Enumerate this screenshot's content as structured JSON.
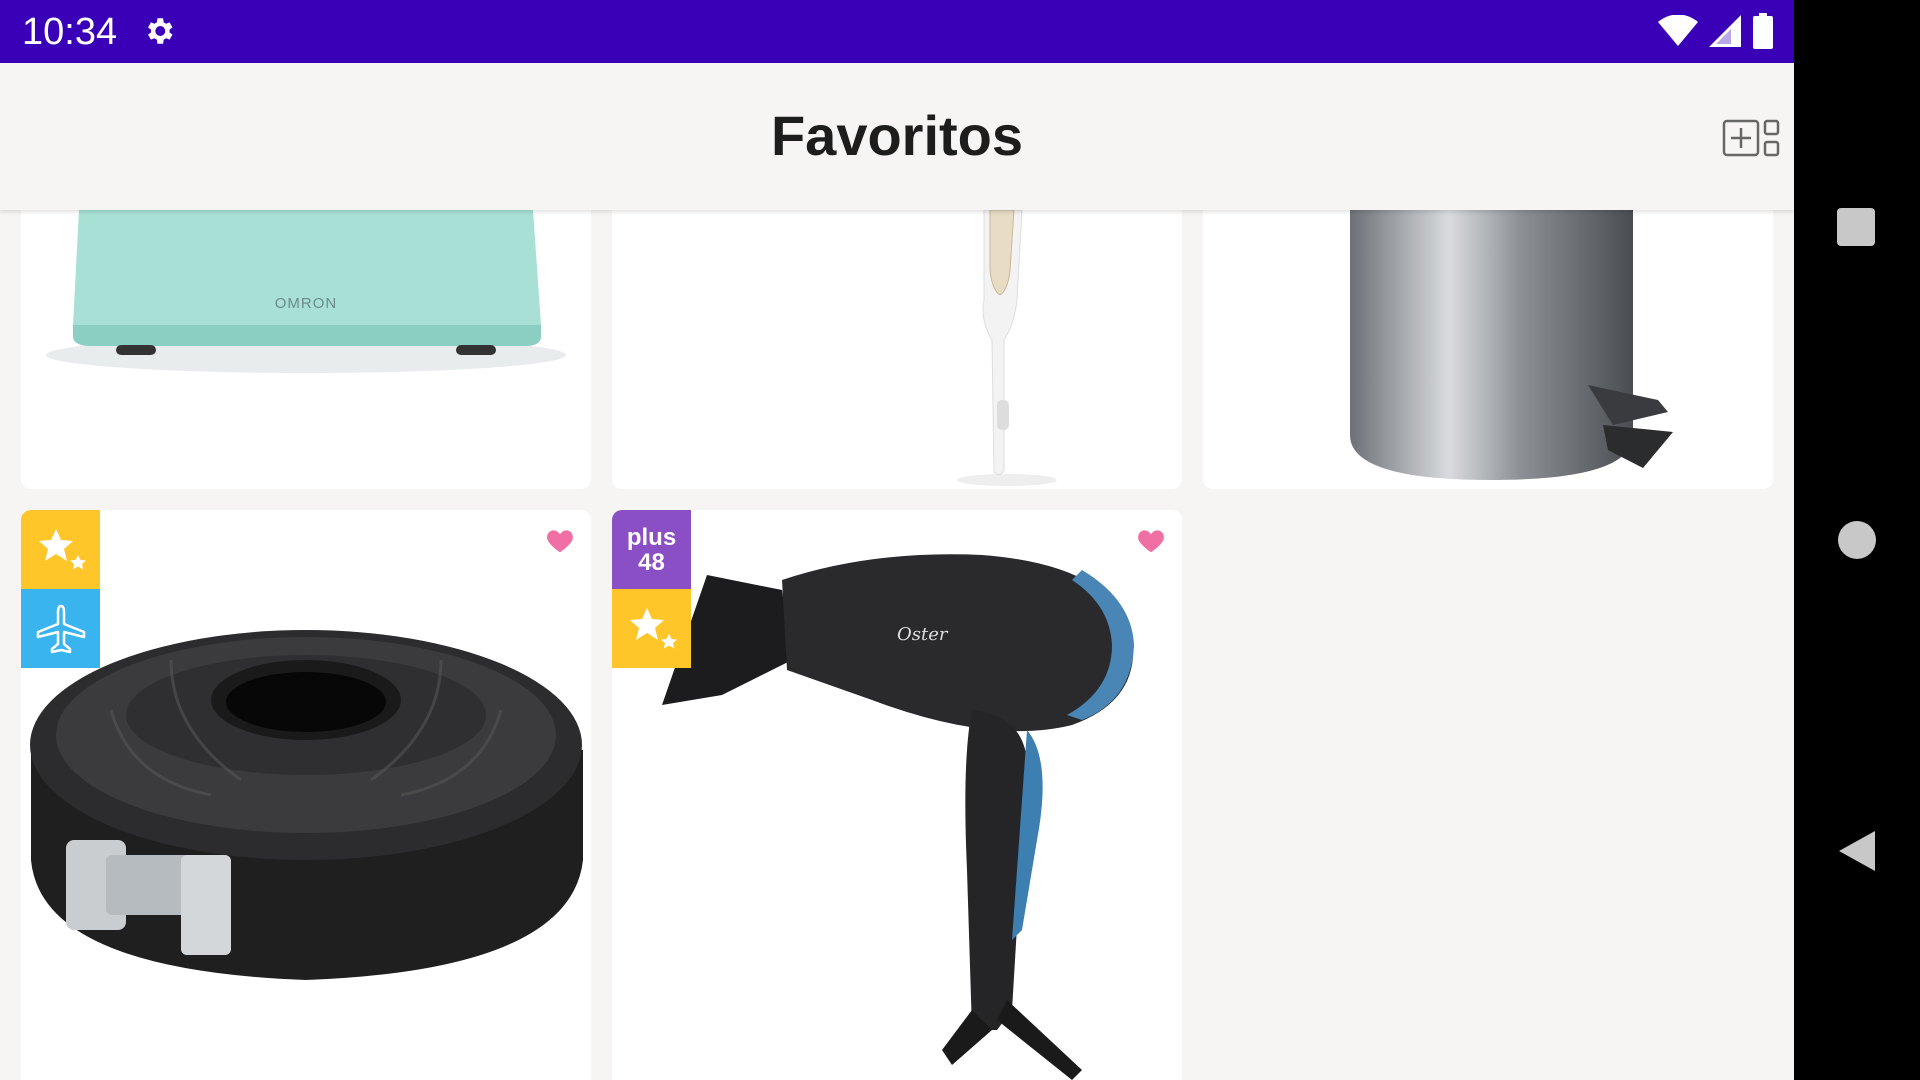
{
  "status_bar": {
    "time": "10:34",
    "settings_icon": "gear-icon",
    "wifi_icon": "wifi-icon",
    "signal_icon": "signal-icon",
    "battery_icon": "battery-icon",
    "background": "#3a00b8"
  },
  "app_bar": {
    "title": "Favoritos",
    "view_toggle_icon": "grid-add-icon"
  },
  "products": [
    {
      "name": "omron-scale",
      "badges": [],
      "favorited": true
    },
    {
      "name": "steam-iron",
      "badges": [],
      "favorited": true
    },
    {
      "name": "pedal-bin",
      "badges": [],
      "favorited": true
    },
    {
      "name": "springform-bundt-pan",
      "badges": [
        "star-icon",
        "airplane-icon"
      ],
      "favorited": true,
      "scale_brand": ""
    },
    {
      "name": "hair-dryer",
      "badges": [
        "plus-48",
        "star-icon"
      ],
      "favorited": true,
      "plus_label": "plus",
      "plus_number": "48",
      "brand": "Oster"
    }
  ],
  "scale_brand": "OMRON",
  "colors": {
    "badge_yellow": "#ffc629",
    "badge_blue": "#3ab4ef",
    "badge_purple": "#8a4fc4",
    "heart": "#f06fa4"
  },
  "nav_bar": {
    "recents_icon": "square-icon",
    "home_icon": "circle-icon",
    "back_icon": "triangle-back-icon"
  }
}
